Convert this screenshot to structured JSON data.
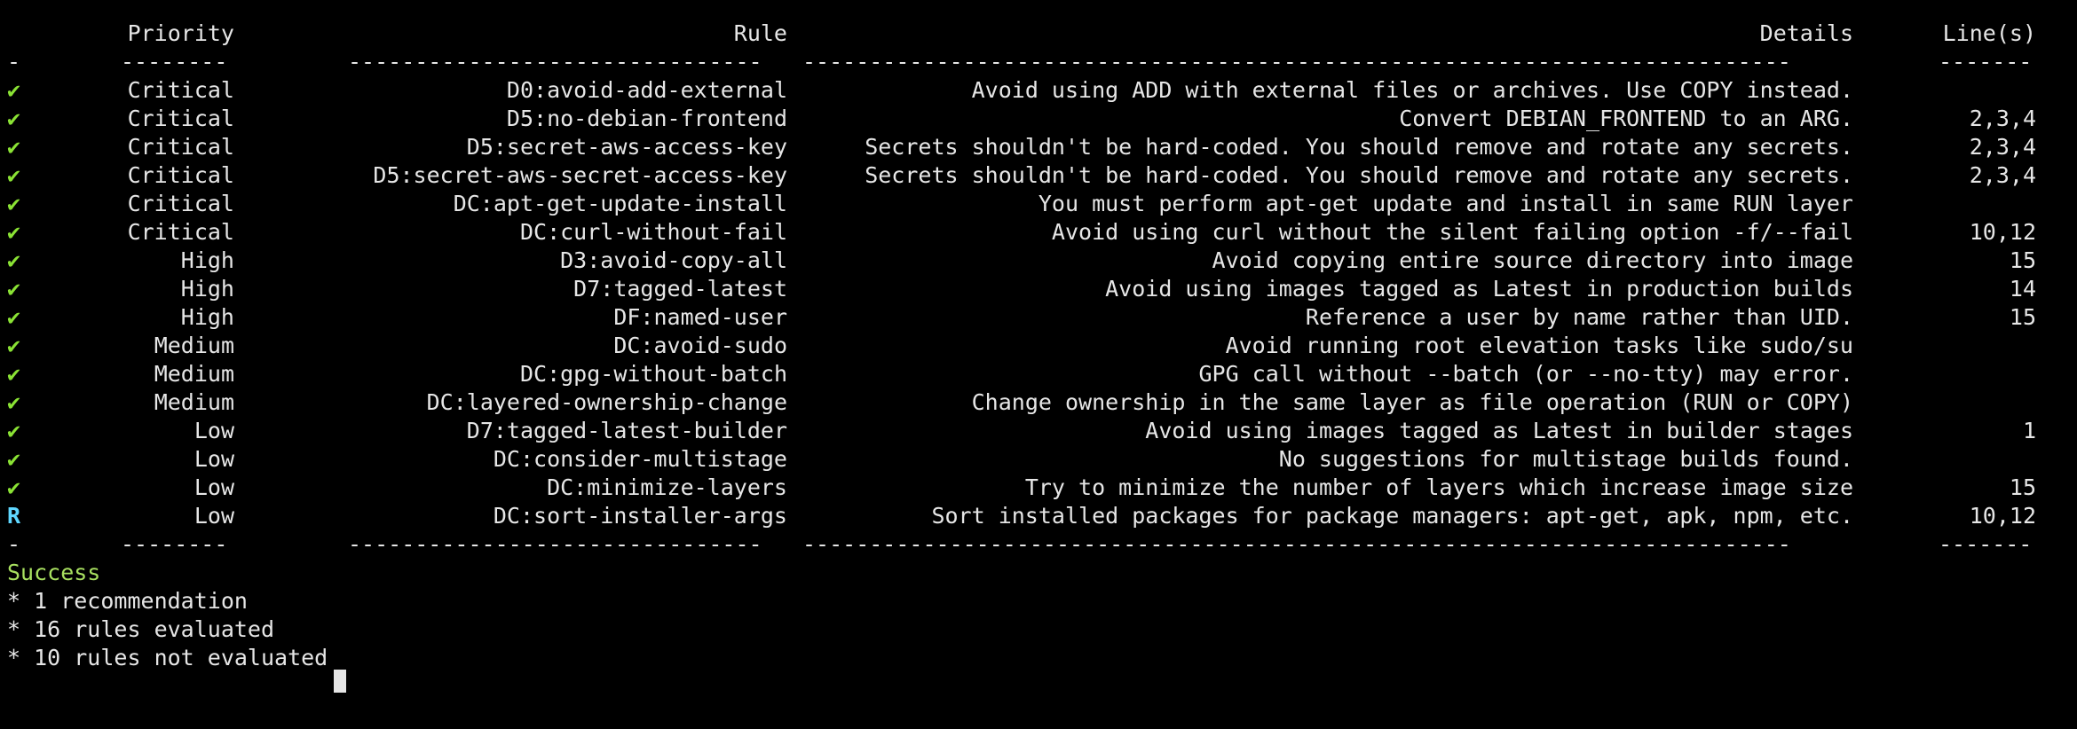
{
  "window": {
    "title": ""
  },
  "table": {
    "headers": {
      "status": "",
      "priority": "Priority",
      "rule": "Rule",
      "details": "Details",
      "lines": "Line(s)"
    },
    "separator": {
      "status": "-",
      "priority": "--------",
      "rule": "-------------------------------",
      "details": "--------------------------------------------------------------------------",
      "lines": "-------"
    },
    "rows": [
      {
        "status": "✔",
        "priority": "Critical",
        "rule": "D0:avoid-add-external",
        "details": "Avoid using ADD with external files or archives. Use COPY instead.",
        "lines": ""
      },
      {
        "status": "✔",
        "priority": "Critical",
        "rule": "D5:no-debian-frontend",
        "details": "Convert DEBIAN_FRONTEND to an ARG.",
        "lines": "2,3,4"
      },
      {
        "status": "✔",
        "priority": "Critical",
        "rule": "D5:secret-aws-access-key",
        "details": "Secrets shouldn't be hard-coded. You should remove and rotate any secrets.",
        "lines": "2,3,4"
      },
      {
        "status": "✔",
        "priority": "Critical",
        "rule": "D5:secret-aws-secret-access-key",
        "details": "Secrets shouldn't be hard-coded. You should remove and rotate any secrets.",
        "lines": "2,3,4"
      },
      {
        "status": "✔",
        "priority": "Critical",
        "rule": "DC:apt-get-update-install",
        "details": "You must perform apt-get update and install in same RUN layer",
        "lines": ""
      },
      {
        "status": "✔",
        "priority": "Critical",
        "rule": "DC:curl-without-fail",
        "details": "Avoid using curl without the silent failing option -f/--fail",
        "lines": "10,12"
      },
      {
        "status": "✔",
        "priority": "High",
        "rule": "D3:avoid-copy-all",
        "details": "Avoid copying entire source directory into image",
        "lines": "15"
      },
      {
        "status": "✔",
        "priority": "High",
        "rule": "D7:tagged-latest",
        "details": "Avoid using images tagged as Latest in production builds",
        "lines": "14"
      },
      {
        "status": "✔",
        "priority": "High",
        "rule": "DF:named-user",
        "details": "Reference a user by name rather than UID.",
        "lines": "15"
      },
      {
        "status": "✔",
        "priority": "Medium",
        "rule": "DC:avoid-sudo",
        "details": "Avoid running root elevation tasks like sudo/su",
        "lines": ""
      },
      {
        "status": "✔",
        "priority": "Medium",
        "rule": "DC:gpg-without-batch",
        "details": "GPG call without --batch (or --no-tty) may error.",
        "lines": ""
      },
      {
        "status": "✔",
        "priority": "Medium",
        "rule": "DC:layered-ownership-change",
        "details": "Change ownership in the same layer as file operation (RUN or COPY)",
        "lines": ""
      },
      {
        "status": "✔",
        "priority": "Low",
        "rule": "D7:tagged-latest-builder",
        "details": "Avoid using images tagged as Latest in builder stages",
        "lines": "1"
      },
      {
        "status": "✔",
        "priority": "Low",
        "rule": "DC:consider-multistage",
        "details": "No suggestions for multistage builds found.",
        "lines": ""
      },
      {
        "status": "✔",
        "priority": "Low",
        "rule": "DC:minimize-layers",
        "details": "Try to minimize the number of layers which increase image size",
        "lines": "15"
      },
      {
        "status": "R",
        "priority": "Low",
        "rule": "DC:sort-installer-args",
        "details": "Sort installed packages for package managers: apt-get, apk, npm, etc.",
        "lines": "10,12"
      }
    ]
  },
  "summary": {
    "result": "Success",
    "lines": [
      "* 1 recommendation",
      "* 16 rules evaluated",
      "* 10 rules not evaluated"
    ]
  },
  "colors": {
    "background": "#000000",
    "text": "#e6e6e6",
    "check": "#8ae234",
    "recommendation": "#5fd7ff",
    "success": "#a8e060",
    "prompt_branch": "#8f7fd7"
  },
  "icons": {
    "pass": "check-mark-icon",
    "recommend": "recommendation-marker-icon"
  }
}
